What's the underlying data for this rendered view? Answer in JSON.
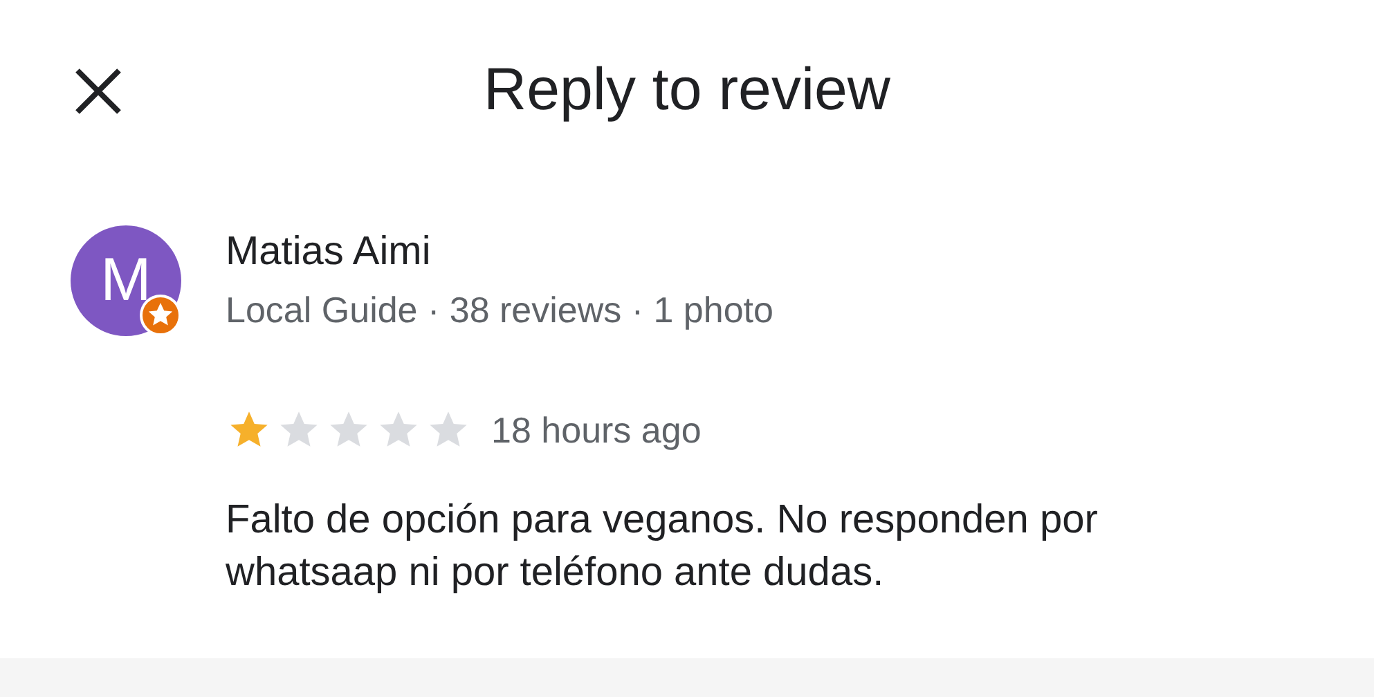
{
  "header": {
    "title": "Reply to review"
  },
  "reviewer": {
    "initial": "M",
    "name": "Matias Aimi",
    "details": "Local Guide · 38 reviews · 1 photo",
    "local_guide": true
  },
  "review": {
    "stars": 1,
    "time": "18 hours ago",
    "text": "Falto de opción para veganos. No responden por whatsaap ni por teléfono ante dudas."
  }
}
